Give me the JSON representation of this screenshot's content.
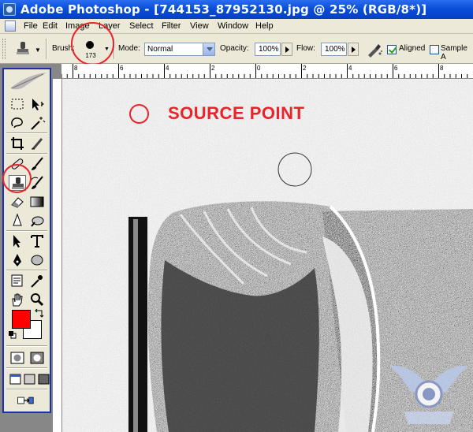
{
  "window": {
    "title": "Adobe Photoshop - [744153_87952130.jpg @ 25% (RGB/8*)]"
  },
  "menu": {
    "items": [
      "File",
      "Edit",
      "Image",
      "Layer",
      "Select",
      "Filter",
      "View",
      "Window",
      "Help"
    ]
  },
  "options_bar": {
    "brush_label": "Brush:",
    "brush_size": "173",
    "mode_label": "Mode:",
    "mode_value": "Normal",
    "opacity_label": "Opacity:",
    "opacity_value": "100%",
    "flow_label": "Flow:",
    "flow_value": "100%",
    "aligned_label": "Aligned",
    "aligned_checked": true,
    "sample_label": "Sample A"
  },
  "ruler": {
    "top_labels": [
      "8",
      "6",
      "4",
      "2",
      "0",
      "2",
      "4",
      "6",
      "8"
    ]
  },
  "annotation": {
    "source_label": "SOURCE POINT",
    "highlight_color": "#e8232a"
  },
  "toolbox": {
    "foreground_color": "#ff0000",
    "background_color": "#ffffff"
  },
  "icons": {
    "app": "photoshop-icon",
    "active_tool": "clone-stamp-icon"
  }
}
